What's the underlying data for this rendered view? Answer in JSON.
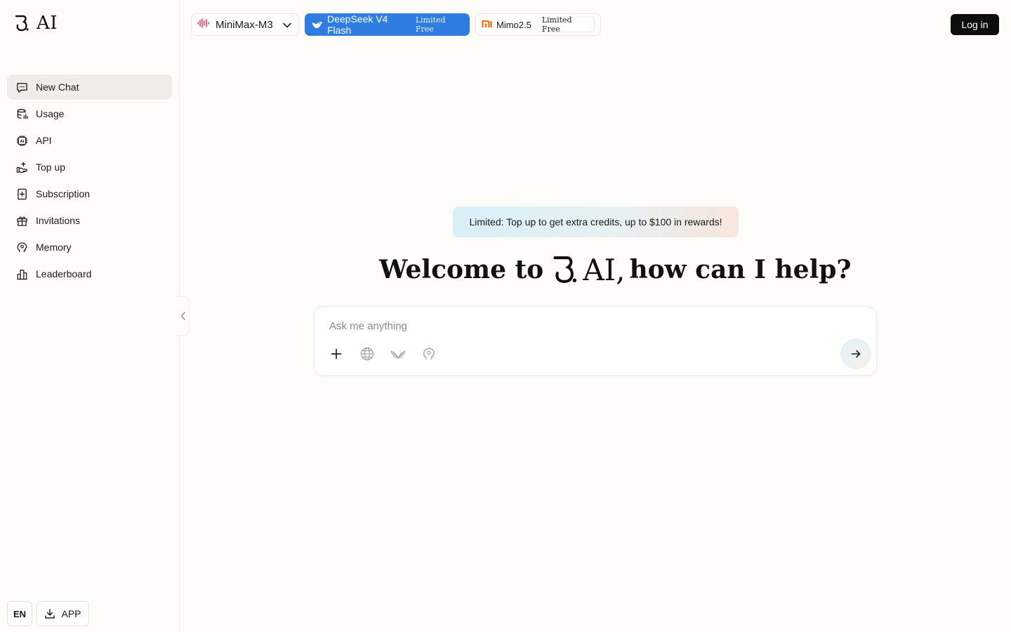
{
  "app": {
    "brand": "AI"
  },
  "sidebar": {
    "items": [
      {
        "label": "New Chat",
        "icon": "chat-icon",
        "active": true
      },
      {
        "label": "Usage",
        "icon": "database-icon"
      },
      {
        "label": "API",
        "icon": "chip-icon"
      },
      {
        "label": "Top up",
        "icon": "wallet-icon"
      },
      {
        "label": "Subscription",
        "icon": "subscription-icon"
      },
      {
        "label": "Invitations",
        "icon": "gift-icon"
      },
      {
        "label": "Memory",
        "icon": "brain-icon"
      },
      {
        "label": "Leaderboard",
        "icon": "leaderboard-icon"
      }
    ],
    "language": "EN",
    "app_button": "APP"
  },
  "topbar": {
    "models": [
      {
        "name": "MiniMax-M3",
        "icon": "minimax-icon"
      },
      {
        "name": "DeepSeek V4 Flash",
        "badge": "Limited Free",
        "icon": "deepseek-icon",
        "accent": "#2f7de1"
      },
      {
        "name": "Mimo2.5",
        "badge": "Limited Free",
        "icon": "mi-icon",
        "accent": "#ff6900"
      }
    ],
    "login": "Log in"
  },
  "main": {
    "promo": "Limited: Top up to get extra credits, up to $100 in rewards!",
    "welcome_prefix": "Welcome to",
    "welcome_brand": "AI,",
    "welcome_suffix": "how can I help?",
    "input_placeholder": "Ask me anything"
  }
}
